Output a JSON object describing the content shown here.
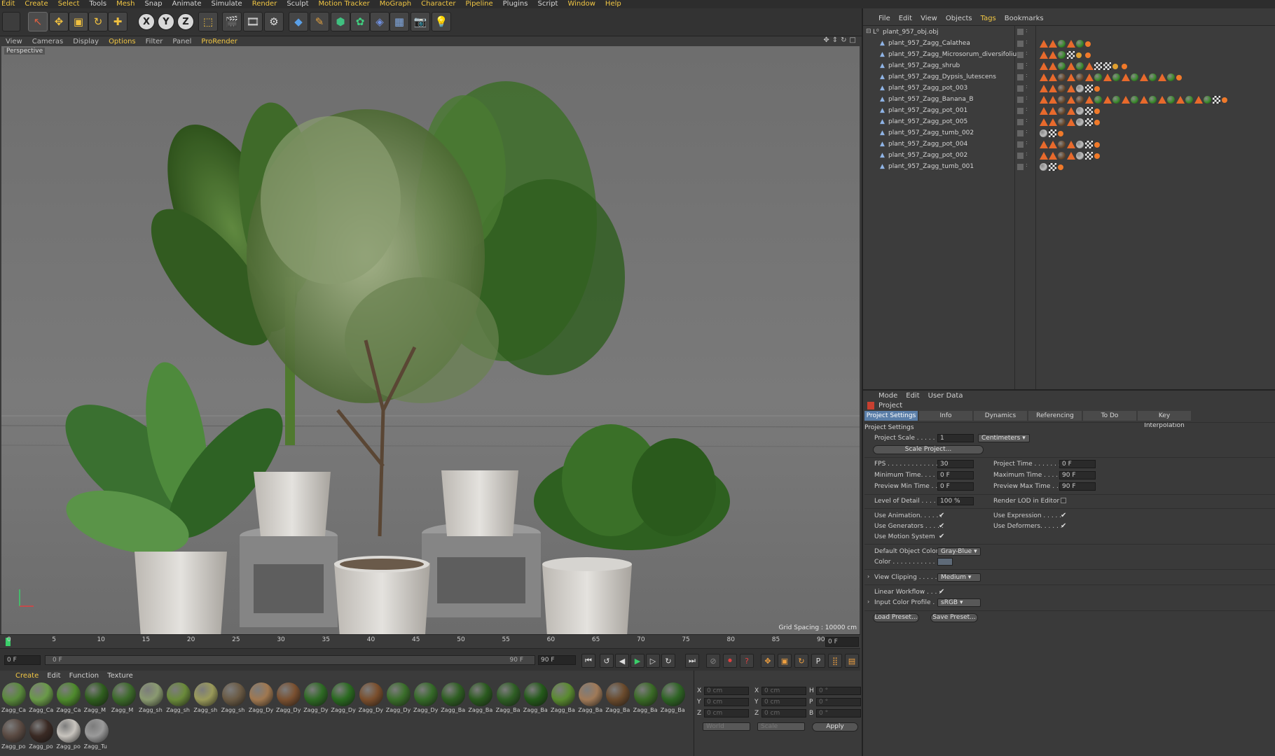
{
  "menubar": [
    "Edit",
    "Create",
    "Select",
    "Tools",
    "Mesh",
    "Snap",
    "Animate",
    "Simulate",
    "Render",
    "Sculpt",
    "Motion Tracker",
    "MoGraph",
    "Character",
    "Pipeline",
    "Plugins",
    "Script",
    "Window",
    "Help"
  ],
  "menubar_highlight": [
    "Edit",
    "Create",
    "Select",
    "Mesh",
    "Render",
    "Motion Tracker",
    "MoGraph",
    "Character",
    "Pipeline",
    "Window",
    "Help"
  ],
  "viewport_menu": [
    "View",
    "Cameras",
    "Display",
    "Options",
    "Filter",
    "Panel",
    "ProRender"
  ],
  "viewport_menu_highlight": [
    "Options",
    "ProRender"
  ],
  "viewport": {
    "label": "Perspective",
    "grid_spacing": "Grid Spacing : 10000 cm"
  },
  "timeline": {
    "ticks": [
      "0",
      "5",
      "10",
      "15",
      "20",
      "25",
      "30",
      "35",
      "40",
      "45",
      "50",
      "55",
      "60",
      "65",
      "70",
      "75",
      "80",
      "85",
      "90"
    ],
    "current_frame": "0 F",
    "start_field": "0 F",
    "range_start": "0 F",
    "range_end": "90 F",
    "end_field": "90 F"
  },
  "material_menu": [
    "Create",
    "Edit",
    "Function",
    "Texture"
  ],
  "materials": [
    {
      "label": "Zagg_Ca",
      "color": "#5a8a3c"
    },
    {
      "label": "Zagg_Ca",
      "color": "#6a9a48"
    },
    {
      "label": "Zagg_Ca",
      "color": "#4e8a2c"
    },
    {
      "label": "Zagg_M",
      "color": "#2f5e1e"
    },
    {
      "label": "Zagg_M",
      "color": "#3c6a2a"
    },
    {
      "label": "Zagg_sh",
      "color": "#8a9a70"
    },
    {
      "label": "Zagg_sh",
      "color": "#6a8a3a"
    },
    {
      "label": "Zagg_sh",
      "color": "#9a9a5a"
    },
    {
      "label": "Zagg_sh",
      "color": "#6a5a44"
    },
    {
      "label": "Zagg_Dy",
      "color": "#a07850"
    },
    {
      "label": "Zagg_Dy",
      "color": "#7a5030"
    },
    {
      "label": "Zagg_Dy",
      "color": "#2e6a24"
    },
    {
      "label": "Zagg_Dy",
      "color": "#2a6a20"
    },
    {
      "label": "Zagg_Dy",
      "color": "#7a4e2c"
    },
    {
      "label": "Zagg_Dy",
      "color": "#3a6e2a"
    },
    {
      "label": "Zagg_Dy",
      "color": "#356a28"
    },
    {
      "label": "Zagg_Ba",
      "color": "#2e5e22"
    },
    {
      "label": "Zagg_Ba",
      "color": "#2a5a1e"
    },
    {
      "label": "Zagg_Ba",
      "color": "#2e5e24"
    },
    {
      "label": "Zagg_Ba",
      "color": "#245a1a"
    },
    {
      "label": "Zagg_Ba",
      "color": "#5a8a30"
    },
    {
      "label": "Zagg_Ba",
      "color": "#a07a58"
    },
    {
      "label": "Zagg_Ba",
      "color": "#6a4a2c"
    },
    {
      "label": "Zagg_Ba",
      "color": "#3a6a26"
    },
    {
      "label": "Zagg_Ba",
      "color": "#2e6424"
    },
    {
      "label": "Zagg_po",
      "color": "#5a4a42"
    },
    {
      "label": "Zagg_po",
      "color": "#3a2a24"
    },
    {
      "label": "Zagg_po",
      "color": "#c8c4be"
    },
    {
      "label": "Zagg_Tu",
      "color": "#9a9a9a"
    }
  ],
  "coords": {
    "rows": [
      {
        "a": "X",
        "av": "0 cm",
        "b": "X",
        "bv": "0 cm",
        "c": "H",
        "cv": "0 °"
      },
      {
        "a": "Y",
        "av": "0 cm",
        "b": "Y",
        "bv": "0 cm",
        "c": "P",
        "cv": "0 °"
      },
      {
        "a": "Z",
        "av": "0 cm",
        "b": "Z",
        "bv": "0 cm",
        "c": "B",
        "cv": "0 °"
      }
    ],
    "world": "World",
    "scale": "Scale",
    "apply": "Apply"
  },
  "object_manager": {
    "menu": [
      "File",
      "Edit",
      "View",
      "Objects",
      "Tags",
      "Bookmarks"
    ],
    "menu_highlight": [
      "Tags"
    ],
    "root": "plant_957_obj.obj",
    "objects": [
      {
        "name": "plant_957_Zagg_Calathea",
        "tags": "ttgtgo"
      },
      {
        "name": "plant_957_Zagg_Microsorum_diversifolium",
        "tags": "ttgcdo"
      },
      {
        "name": "plant_957_Zagg_shrub",
        "tags": "ttgtgtccdo"
      },
      {
        "name": "plant_957_Zagg_Dypsis_lutescens",
        "tags": "ttbtbtgtgtgtgtgo"
      },
      {
        "name": "plant_957_Zagg_pot_003",
        "tags": "ttbtsco"
      },
      {
        "name": "plant_957_Zagg_Banana_B",
        "tags": "ttbtbtgtgtgtgtgtgtgco"
      },
      {
        "name": "plant_957_Zagg_pot_001",
        "tags": "ttbtsco"
      },
      {
        "name": "plant_957_Zagg_pot_005",
        "tags": "ttbtsco"
      },
      {
        "name": "plant_957_Zagg_tumb_002",
        "tags": "sco"
      },
      {
        "name": "plant_957_Zagg_pot_004",
        "tags": "ttbtsco"
      },
      {
        "name": "plant_957_Zagg_pot_002",
        "tags": "ttbtsco"
      },
      {
        "name": "plant_957_Zagg_tumb_001",
        "tags": "sco"
      }
    ]
  },
  "attributes": {
    "menu": [
      "Mode",
      "Edit",
      "User Data"
    ],
    "title": "Project",
    "tabs": [
      "Project Settings",
      "Info",
      "Dynamics",
      "Referencing",
      "To Do",
      "Key Interpolation"
    ],
    "section": "Project Settings",
    "project_scale_label": "Project Scale . . . . . .",
    "project_scale_value": "1",
    "project_scale_unit": "Centimeters",
    "scale_project_btn": "Scale Project...",
    "fps_label": "FPS . . . . . . . . . . . . .",
    "fps": "30",
    "project_time_label": "Project Time . . . . . . .",
    "project_time": "0 F",
    "min_time_label": "Minimum Time. . . . . .",
    "min_time": "0 F",
    "max_time_label": "Maximum Time . . . . .",
    "max_time": "90 F",
    "prev_min_label": "Preview Min Time . . .",
    "prev_min": "0 F",
    "prev_max_label": "Preview Max Time . . .",
    "prev_max": "90 F",
    "lod_label": "Level of Detail . . . . .",
    "lod": "100 %",
    "render_lod_label": "Render LOD in Editor",
    "use_anim_label": "Use Animation. . . . . .",
    "use_expr_label": "Use Expression . . . . .",
    "use_gen_label": "Use Generators . . . . .",
    "use_def_label": "Use Deformers. . . . . .",
    "use_motion_label": "Use Motion System",
    "def_color_label": "Default Object Color",
    "def_color": "Gray-Blue",
    "color_label": "Color . . . . . . . . . . .",
    "view_clip_label": "View Clipping . . . . . .",
    "view_clip": "Medium",
    "linear_label": "Linear Workflow . . . .",
    "input_profile_label": "Input Color Profile . . .",
    "input_profile": "sRGB",
    "load_preset": "Load Preset...",
    "save_preset": "Save Preset..."
  },
  "colors": {
    "accent": "#f2c744",
    "tab_active": "#5a7ea8",
    "tag_orange": "#e86a2c"
  }
}
